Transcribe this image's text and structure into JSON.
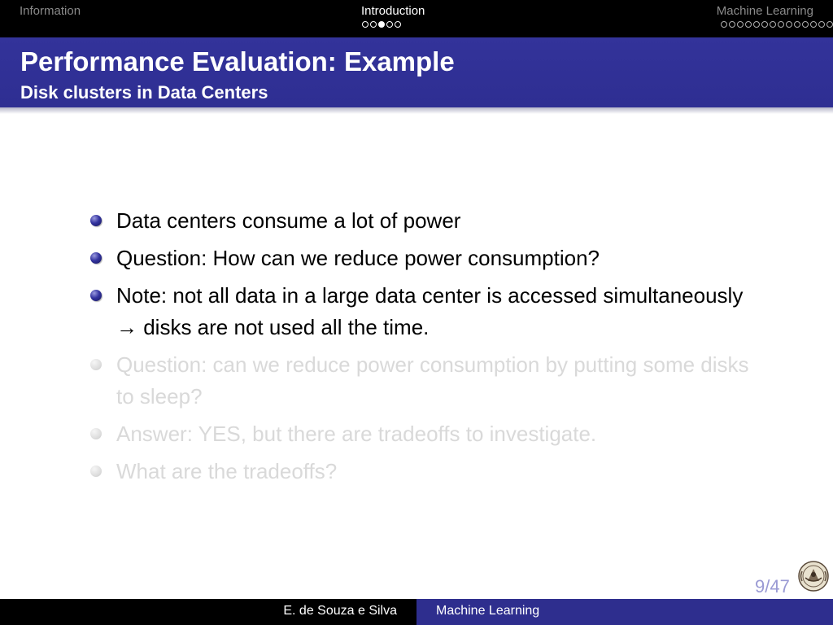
{
  "nav": {
    "sections": [
      {
        "label": "Information",
        "active": false,
        "dots": 0,
        "current_dot": -1
      },
      {
        "label": "Introduction",
        "active": true,
        "dots": 5,
        "current_dot": 2
      },
      {
        "label": "Machine Learning",
        "active": false,
        "dots": 14,
        "current_dot": -1
      }
    ]
  },
  "frame": {
    "title": "Performance Evaluation: Example",
    "subtitle": "Disk clusters in Data Centers"
  },
  "bullets": [
    {
      "text": "Data centers consume a lot of power",
      "dimmed": false
    },
    {
      "text": "Question: How can we reduce power consumption?",
      "dimmed": false
    },
    {
      "text": "Note: not all data in a large data center is accessed simultaneously → disks are not used all the time.",
      "dimmed": false
    },
    {
      "text": "Question: can we reduce power consumption by putting some disks to sleep?",
      "dimmed": true
    },
    {
      "text": "Answer: YES, but there are tradeoffs to investigate.",
      "dimmed": true
    },
    {
      "text": "What are the tradeoffs?",
      "dimmed": true
    }
  ],
  "page_number": "9/47",
  "footer": {
    "author": "E. de Souza e Silva",
    "short_title": "Machine Learning"
  },
  "colors": {
    "title_bar": "#33339a",
    "footer_right": "#2e2e8e",
    "dimmed_text": "#d9d9d9",
    "page_number": "#9a9ad4"
  },
  "icons": {
    "logo": "university-seal-icon",
    "bullet": "ball-bullet-icon"
  }
}
